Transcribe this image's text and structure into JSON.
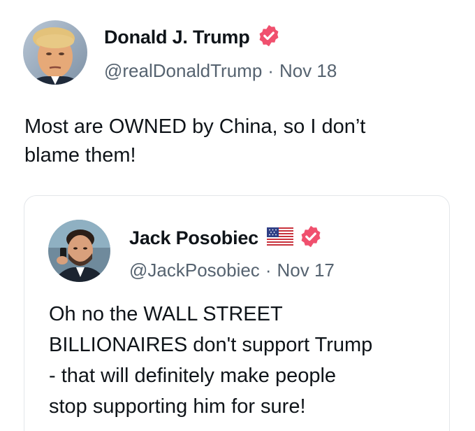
{
  "main_tweet": {
    "author_name": "Donald J. Trump",
    "handle": "@realDonaldTrump",
    "separator": "·",
    "date": "Nov 18",
    "text_lines": [
      "Most are OWNED by China, so I don’t",
      "blame them!"
    ],
    "verified": true
  },
  "quoted_tweet": {
    "author_name": "Jack Posobiec",
    "flag_icon": "us-flag-icon",
    "handle": "@JackPosobiec",
    "separator": "·",
    "date": "Nov 17",
    "text_lines": [
      "Oh no the WALL STREET",
      "BILLIONAIRES don't support Trump",
      "- that will definitely make people",
      "stop supporting him for sure!"
    ],
    "verified": true
  },
  "colors": {
    "verified_badge": "#f0506e",
    "text_primary": "#0f1419",
    "text_secondary": "#566370",
    "card_border": "#e3e6ea"
  }
}
